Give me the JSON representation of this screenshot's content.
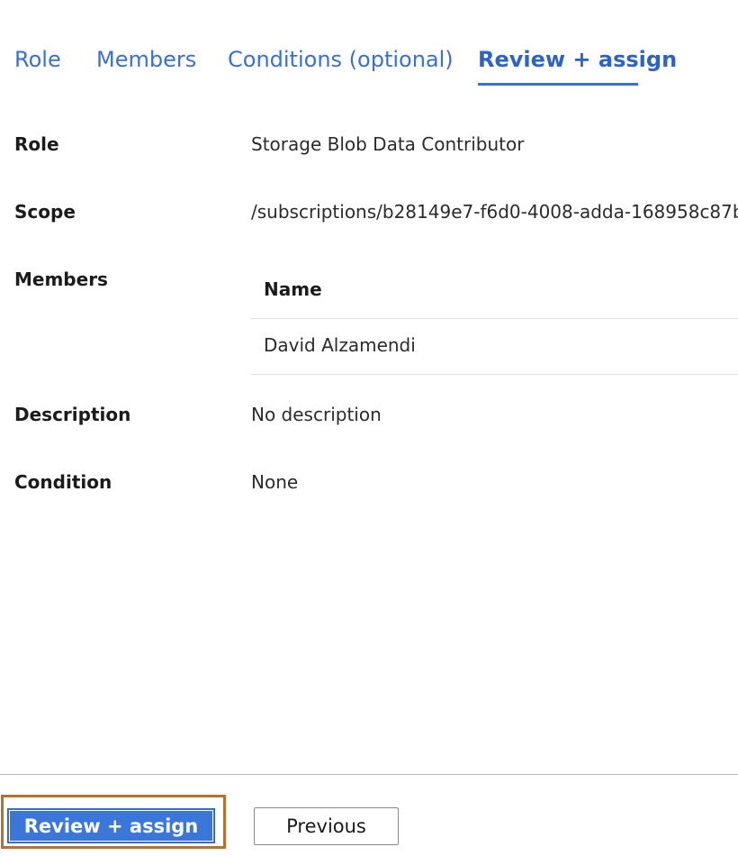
{
  "tabs": [
    {
      "label": "Role",
      "active": false
    },
    {
      "label": "Members",
      "active": false
    },
    {
      "label": "Conditions (optional)",
      "active": false
    },
    {
      "label": "Review + assign",
      "active": true
    }
  ],
  "details": {
    "role": {
      "label": "Role",
      "value": "Storage Blob Data Contributor"
    },
    "scope": {
      "label": "Scope",
      "value": "/subscriptions/b28149e7-f6d0-4008-adda-168958c87b"
    },
    "members": {
      "label": "Members",
      "column_header": "Name",
      "rows": [
        "David Alzamendi"
      ]
    },
    "description": {
      "label": "Description",
      "value": "No description"
    },
    "condition": {
      "label": "Condition",
      "value": "None"
    }
  },
  "footer": {
    "review_assign_label": "Review + assign",
    "previous_label": "Previous"
  },
  "colors": {
    "accent": "#3a6fd8",
    "primary_button": "#3b76d9",
    "highlight_border": "#b8702e"
  }
}
